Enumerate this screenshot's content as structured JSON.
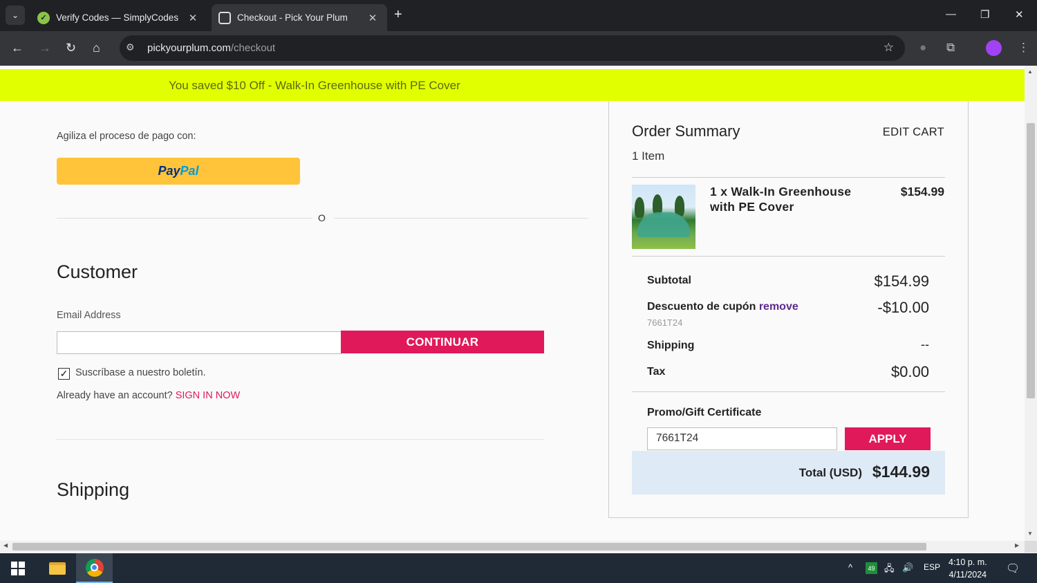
{
  "browser": {
    "tabs": [
      {
        "title": "Verify Codes — SimplyCodes",
        "active": false
      },
      {
        "title": "Checkout - Pick Your Plum",
        "active": true
      }
    ],
    "url_domain": "pickyourplum.com",
    "url_path": "/checkout",
    "icons": {
      "back": "←",
      "forward": "→",
      "reload": "↻",
      "home": "⌂",
      "star": "☆",
      "menu": "⋮",
      "close": "✕",
      "new_tab": "+",
      "minimize": "—",
      "maximize": "❐"
    }
  },
  "banner": {
    "text": "You saved $10 Off - Walk-In Greenhouse with PE Cover",
    "color": "#e2ff00"
  },
  "checkout": {
    "express_label": "Agiliza el proceso de pago con:",
    "paypal_pay": "Pay",
    "paypal_pal": "Pal",
    "divider_text": "O",
    "customer_heading": "Customer",
    "email_label": "Email Address",
    "email_value": "",
    "continue_button": "CONTINUAR",
    "newsletter_label": "Suscríbase a nuestro boletín.",
    "newsletter_checked": true,
    "account_prompt": "Already have an account?",
    "sign_in_link": "SIGN IN NOW",
    "shipping_heading": "Shipping"
  },
  "summary": {
    "title": "Order Summary",
    "edit_cart": "EDIT CART",
    "item_count": "1 Item",
    "product_name": "1 x Walk-In Greenhouse with PE Cover",
    "product_price": "$154.99",
    "subtotal_label": "Subtotal",
    "subtotal_value": "$154.99",
    "discount_label": "Descuento de cupón",
    "discount_remove": "remove",
    "discount_code": "7661T24",
    "discount_value": "-$10.00",
    "shipping_label": "Shipping",
    "shipping_value": "--",
    "tax_label": "Tax",
    "tax_value": "$0.00",
    "promo_label": "Promo/Gift Certificate",
    "promo_value": "7661T24",
    "apply_button": "APPLY",
    "total_label": "Total (USD)",
    "total_value": "$144.99"
  },
  "taskbar": {
    "battery_badge": "49",
    "language": "ESP",
    "time": "4:10 p. m.",
    "date": "4/11/2024"
  },
  "colors": {
    "accent": "#e0195a",
    "paypal": "#ffc439",
    "total_bg": "#dfeaf7"
  }
}
